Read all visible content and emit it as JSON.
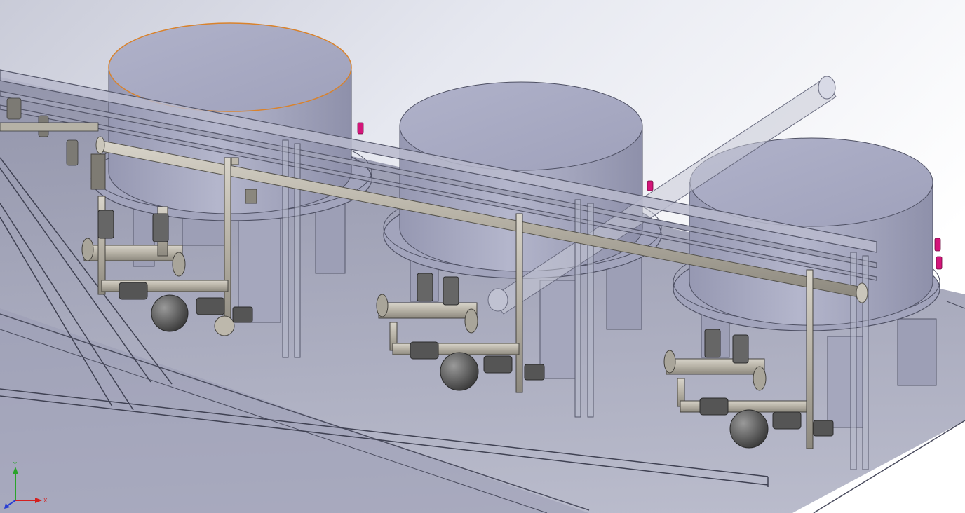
{
  "view": {
    "background_top": "#ffffff",
    "background_bottom": "#c9cbd8",
    "model_color": "#a8abc4",
    "pipe_color": "#bdb8ac",
    "highlight_edge_color": "#d9822b",
    "flange_accent": "#d4157a"
  },
  "triad": {
    "x_label": "X",
    "y_label": "Y",
    "z_label": "Z",
    "x_color": "#d41f1f",
    "y_color": "#2aa32a",
    "z_color": "#2a3fd4"
  },
  "model": {
    "tanks": [
      "tank-1",
      "tank-2",
      "tank-3"
    ]
  }
}
